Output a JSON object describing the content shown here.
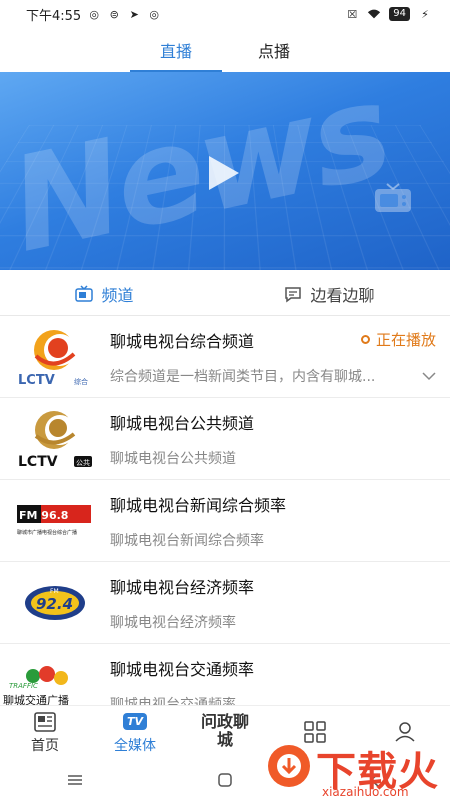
{
  "status_bar": {
    "time": "下午4:55",
    "battery": "94"
  },
  "top_tabs": [
    {
      "label": "直播",
      "active": true
    },
    {
      "label": "点播",
      "active": false
    }
  ],
  "banner": {
    "background_text": "News"
  },
  "sub_tabs": [
    {
      "label": "频道",
      "active": true,
      "icon": "tv-small-icon"
    },
    {
      "label": "边看边聊",
      "active": false,
      "icon": "chat-icon"
    }
  ],
  "channels": [
    {
      "title": "聊城电视台综合频道",
      "desc": "综合频道是一档新闻类节目，内含有聊城...",
      "status": "正在播放",
      "logo_text": "LCTV",
      "logo_sub": "综合"
    },
    {
      "title": "聊城电视台公共频道",
      "desc": "聊城电视台公共频道",
      "logo_text": "LCTV",
      "logo_sub": "公共"
    },
    {
      "title": "聊城电视台新闻综合频率",
      "desc": "聊城电视台新闻综合频率",
      "logo_text": "FM 96.8",
      "logo_sub": "聊城市广播电视台综合广播"
    },
    {
      "title": "聊城电视台经济频率",
      "desc": "聊城电视台经济频率",
      "logo_text": "92.4",
      "logo_sub": "FM"
    },
    {
      "title": "聊城电视台交通频率",
      "desc": "聊城电视台交通频率",
      "logo_text": "TRAFFIC",
      "logo_sub": "聊城交通广播"
    }
  ],
  "bottom_nav": [
    {
      "label": "首页",
      "icon": "news-icon",
      "active": false
    },
    {
      "label": "全媒体",
      "icon": "tv-badge-icon",
      "badge": "TV",
      "active": true
    },
    {
      "label": "问政聊城",
      "icon": "wenzheng-icon",
      "active": false
    },
    {
      "label": "",
      "icon": "grid-icon",
      "active": false
    },
    {
      "label": "",
      "icon": "user-icon",
      "active": false
    }
  ],
  "watermark": {
    "text": "下载火",
    "url": "xiazaihuo.com"
  },
  "colors": {
    "accent": "#2f7fd6",
    "playing": "#e07a1a",
    "watermark": "#e8442c"
  }
}
